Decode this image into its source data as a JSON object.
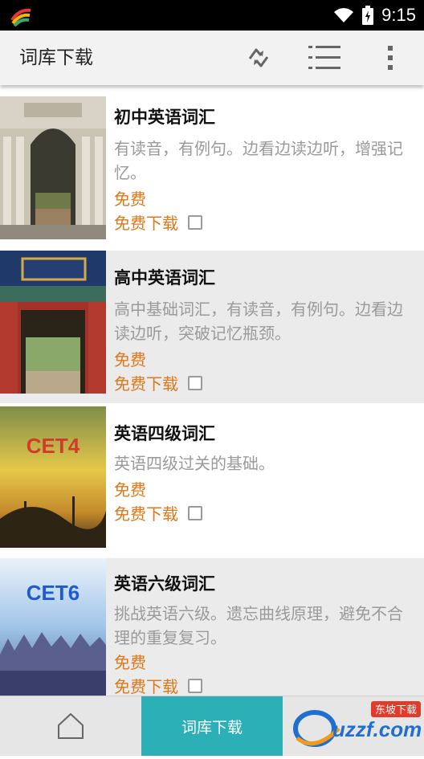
{
  "status_bar": {
    "time": "9:15"
  },
  "action_bar": {
    "title": "词库下载",
    "icons": [
      "sync-icon",
      "list-icon",
      "overflow-menu-icon"
    ]
  },
  "items": [
    {
      "name": "初中英语词汇",
      "desc": "有读音，有例句。边看边读边听，增强记忆。",
      "price": "免费",
      "download_label": "免费下载",
      "thumb": "university-gate-image"
    },
    {
      "name": "高中英语词汇",
      "desc": "高中基础词汇，有读音，有例句。边看边读边听，突破记忆瓶颈。",
      "price": "免费",
      "download_label": "免费下载",
      "thumb": "peking-university-gate-image"
    },
    {
      "name": "英语四级词汇",
      "desc": "英语四级过关的基础。",
      "price": "免费",
      "download_label": "免费下载",
      "thumb": "cet4-cover-image",
      "thumb_text": "CET4"
    },
    {
      "name": "英语六级词汇",
      "desc": "挑战英语六级。遗忘曲线原理，避免不合理的重复复习。",
      "price": "免费",
      "download_label": "免费下载",
      "thumb": "cet6-cover-image",
      "thumb_text": "CET6"
    }
  ],
  "bottom_bar": {
    "active_tab": "词库下载",
    "logo_text": "uzzf.com",
    "logo_sub": "东坡下载"
  },
  "colors": {
    "accent": "#e0781a",
    "tab_active": "#2bb0b8"
  }
}
